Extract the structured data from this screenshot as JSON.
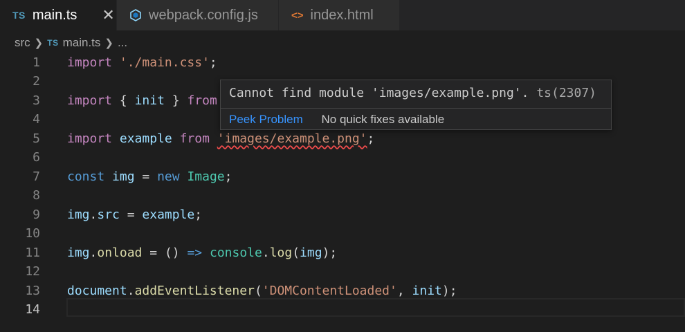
{
  "tabs": [
    {
      "label": "main.ts",
      "icon": "typescript-icon",
      "icon_text": "TS",
      "active": true
    },
    {
      "label": "webpack.config.js",
      "icon": "webpack-icon",
      "active": false
    },
    {
      "label": "index.html",
      "icon": "html-icon",
      "icon_text": "<>",
      "active": false
    }
  ],
  "close_glyph": "✕",
  "breadcrumb": {
    "folder": "src",
    "file": "main.ts",
    "file_icon_text": "TS",
    "rest": "..."
  },
  "line_numbers": [
    "1",
    "2",
    "3",
    "4",
    "5",
    "6",
    "7",
    "8",
    "9",
    "10",
    "11",
    "12",
    "13",
    "14"
  ],
  "code": {
    "l1": {
      "kw": "import",
      "str": "'./main.css'",
      "end": ";"
    },
    "l3": {
      "kw": "import",
      "open": "{",
      "name": "init",
      "close": "}",
      "from": "from"
    },
    "l5": {
      "kw": "import",
      "name": "example",
      "from": "from",
      "str": "'images/example.png'",
      "end": ";"
    },
    "l7": {
      "kw": "const",
      "name": "img",
      "eq": "=",
      "new": "new",
      "cls": "Image",
      "end": ";"
    },
    "l9": {
      "obj": "img",
      "dot": ".",
      "prop": "src",
      "eq": "=",
      "val": "example",
      "end": ";"
    },
    "l11": {
      "obj": "img",
      "dot": ".",
      "prop": "onload",
      "eq": "=",
      "parens": "()",
      "arrow": "=>",
      "console": "console",
      "dot2": ".",
      "fn": "log",
      "open": "(",
      "arg": "img",
      "close": ");"
    },
    "l13": {
      "obj": "document",
      "dot": ".",
      "fn": "addEventListener",
      "open": "(",
      "str": "'DOMContentLoaded'",
      "comma": ",",
      "arg": "init",
      "close": ");"
    }
  },
  "hover": {
    "message": "Cannot find module 'images/example.png'.",
    "code": "ts(2307)",
    "peek_problem": "Peek Problem",
    "no_fixes": "No quick fixes available"
  },
  "colors": {
    "background": "#1e1e1e",
    "keyword": "#c586c0",
    "string": "#ce9178",
    "variable": "#9cdcfe",
    "link": "#3794ff",
    "error_squiggle": "#f14c4c"
  }
}
